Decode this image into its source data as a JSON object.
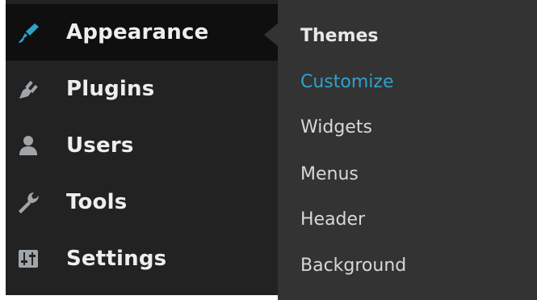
{
  "colors": {
    "sidebar_bg": "#222222",
    "active_bg": "#0f0f0f",
    "submenu_bg": "#333333",
    "accent": "#2ea2cc",
    "text": "#eeeeee",
    "submenu_text": "#d8d8d8"
  },
  "sidebar": {
    "items": [
      {
        "label": "Appearance",
        "icon": "paintbrush-icon",
        "active": true
      },
      {
        "label": "Plugins",
        "icon": "plug-icon",
        "active": false
      },
      {
        "label": "Users",
        "icon": "user-icon",
        "active": false
      },
      {
        "label": "Tools",
        "icon": "wrench-icon",
        "active": false
      },
      {
        "label": "Settings",
        "icon": "sliders-icon",
        "active": false
      }
    ]
  },
  "submenu": {
    "items": [
      {
        "label": "Themes",
        "current": false
      },
      {
        "label": "Customize",
        "current": true
      },
      {
        "label": "Widgets",
        "current": false
      },
      {
        "label": "Menus",
        "current": false
      },
      {
        "label": "Header",
        "current": false
      },
      {
        "label": "Background",
        "current": false
      }
    ]
  }
}
